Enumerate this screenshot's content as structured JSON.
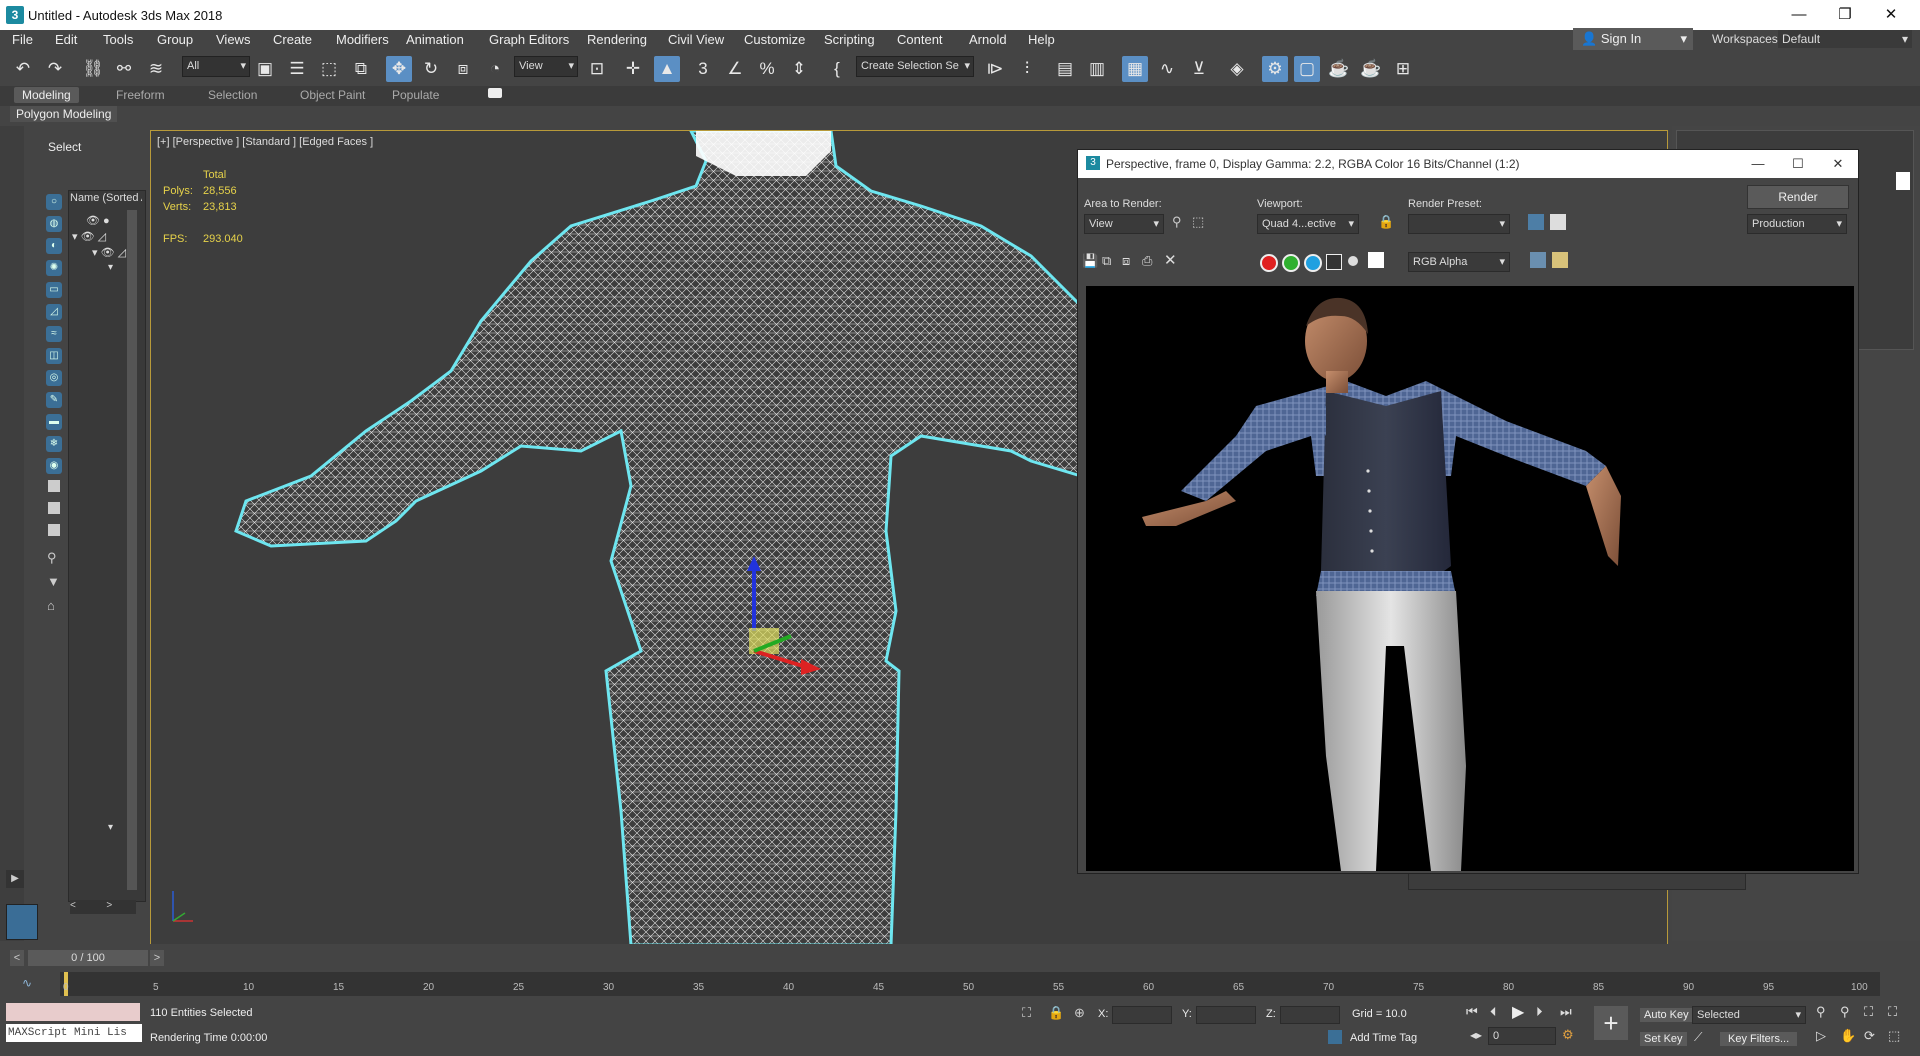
{
  "app": {
    "title": "Untitled - Autodesk 3ds Max 2018",
    "icon": "3"
  },
  "window_controls": {
    "minimize": "—",
    "maximize": "❐",
    "close": "✕"
  },
  "menu": [
    "File",
    "Edit",
    "Tools",
    "Group",
    "Views",
    "Create",
    "Modifiers",
    "Animation",
    "Graph Editors",
    "Rendering",
    "Civil View",
    "Customize",
    "Scripting",
    "Content",
    "Arnold",
    "Help"
  ],
  "account": {
    "sign_in": "Sign In",
    "workspace_label": "Workspaces:",
    "workspace_value": "Default"
  },
  "toolbar": {
    "filter_value": "All",
    "coord_value": "View",
    "selection_set_value": "Create Selection Se"
  },
  "ribbon": {
    "tabs": [
      "Modeling",
      "Freeform",
      "Selection",
      "Object Paint",
      "Populate"
    ],
    "active_tab": "Modeling",
    "sub_label": "Polygon Modeling"
  },
  "scene_explorer": {
    "select_label": "Select",
    "column_header": "Name (Sorted A"
  },
  "viewport": {
    "label": "[+] [Perspective ] [Standard ] [Edged Faces ]",
    "stats": {
      "total_label": "Total",
      "polys_label": "Polys:",
      "polys_value": "28,556",
      "verts_label": "Verts:",
      "verts_value": "23,813",
      "fps_label": "FPS:",
      "fps_value": "293.040"
    }
  },
  "render_window": {
    "title": "Perspective, frame 0, Display Gamma: 2.2, RGBA Color 16 Bits/Channel (1:2)",
    "area_label": "Area to Render:",
    "area_value": "View",
    "viewport_label": "Viewport:",
    "viewport_value": "Quad 4...ective",
    "preset_label": "Render Preset:",
    "preset_value": "",
    "render_button": "Render",
    "mode_value": "Production",
    "channel_value": "RGB Alpha",
    "channel_colors": [
      "#e02020",
      "#30b030",
      "#20a0e0"
    ]
  },
  "timeline": {
    "frame_display": "0 / 100",
    "ticks": [
      "0",
      "5",
      "10",
      "15",
      "20",
      "25",
      "30",
      "35",
      "40",
      "45",
      "50",
      "55",
      "60",
      "65",
      "70",
      "75",
      "80",
      "85",
      "90",
      "95",
      "100"
    ]
  },
  "status": {
    "maxscript_label": "MAXScript Mini Lis",
    "selection_status": "110 Entities Selected",
    "rendering_time": "Rendering Time  0:00:00",
    "x_label": "X:",
    "y_label": "Y:",
    "z_label": "Z:",
    "grid": "Grid = 10.0",
    "add_time_tag": "Add Time Tag",
    "auto_key": "Auto Key",
    "selected_value": "Selected",
    "set_key": "Set Key",
    "key_filters": "Key Filters...",
    "frame_spinner": "0"
  }
}
